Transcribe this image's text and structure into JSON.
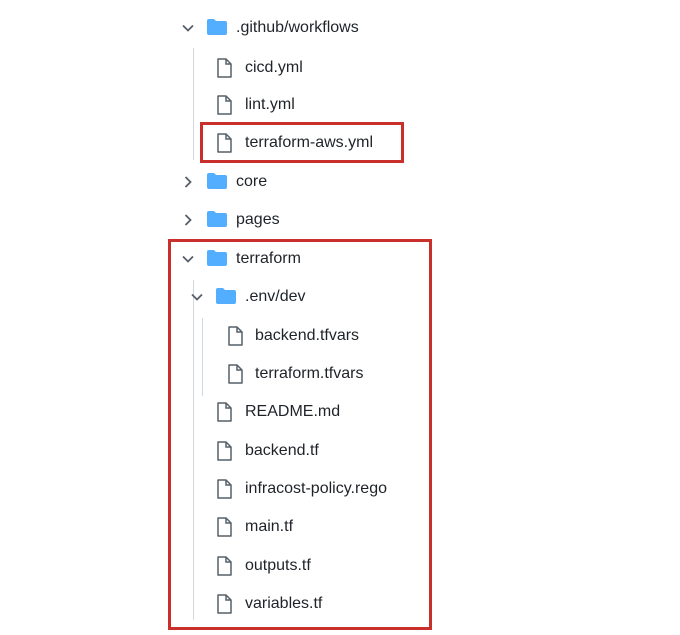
{
  "tree": {
    "github_workflows": {
      "label": ".github/workflows",
      "icon": "folder-open-icon"
    },
    "cicd": {
      "label": "cicd.yml",
      "icon": "file-icon"
    },
    "lint": {
      "label": "lint.yml",
      "icon": "file-icon"
    },
    "terraform_aws": {
      "label": "terraform-aws.yml",
      "icon": "file-icon"
    },
    "core": {
      "label": "core",
      "icon": "folder-icon"
    },
    "pages": {
      "label": "pages",
      "icon": "folder-icon"
    },
    "terraform": {
      "label": "terraform",
      "icon": "folder-open-icon"
    },
    "env_dev": {
      "label": ".env/dev",
      "icon": "folder-open-icon"
    },
    "backend_tfvars": {
      "label": "backend.tfvars",
      "icon": "file-icon"
    },
    "terraform_tfvars": {
      "label": "terraform.tfvars",
      "icon": "file-icon"
    },
    "readme": {
      "label": "README.md",
      "icon": "file-icon"
    },
    "backend_tf": {
      "label": "backend.tf",
      "icon": "file-icon"
    },
    "infracost": {
      "label": "infracost-policy.rego",
      "icon": "file-icon"
    },
    "main_tf": {
      "label": "main.tf",
      "icon": "file-icon"
    },
    "outputs_tf": {
      "label": "outputs.tf",
      "icon": "file-icon"
    },
    "variables_tf": {
      "label": "variables.tf",
      "icon": "file-icon"
    }
  },
  "colors": {
    "folder": "#54aeff",
    "highlight": "#c9302c",
    "guide": "#d0d7de",
    "icon_stroke": "#57606a"
  }
}
